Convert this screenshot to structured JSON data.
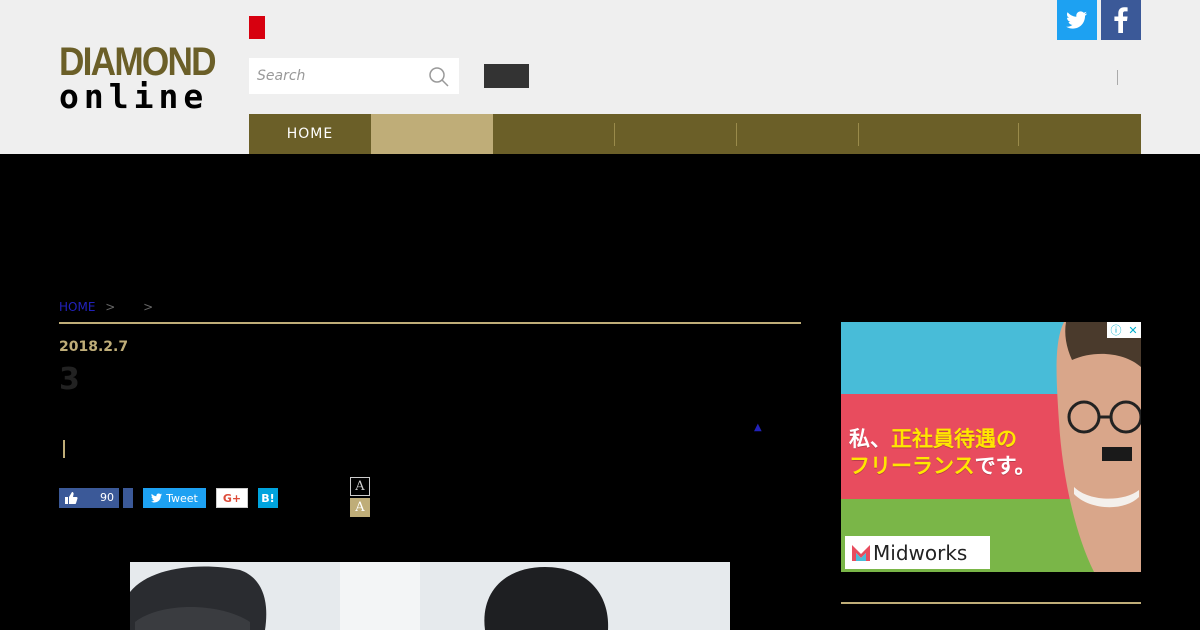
{
  "logo": {
    "line1": "DIAMOND",
    "line2": "online"
  },
  "search": {
    "placeholder": "Search"
  },
  "nav": {
    "items": [
      {
        "label": "HOME",
        "active": false
      },
      {
        "label": "",
        "active": true
      },
      {
        "label": "",
        "active": false
      },
      {
        "label": "",
        "active": false
      },
      {
        "label": "",
        "active": false
      },
      {
        "label": "",
        "active": false
      },
      {
        "label": "",
        "active": false
      }
    ]
  },
  "breadcrumb": {
    "home": "HOME",
    "sep1": ">",
    "sep2": ">"
  },
  "article": {
    "date": "2018.2.7",
    "title": "3"
  },
  "share": {
    "like_count": "90",
    "tweet_label": "Tweet",
    "gplus_label": "G+",
    "hatena_label": "B!"
  },
  "font_size": {
    "a1": "A",
    "a2": "A"
  },
  "ad": {
    "line1_white": "私、",
    "line1_yellow": "正社員待遇の",
    "line2_yellow": "フリーランス",
    "line2_white": "です。",
    "brand": "Midworks"
  },
  "colors": {
    "brand": "#6b5f28",
    "accent": "#bfad78",
    "twitter": "#1da1f2",
    "facebook": "#3b5998",
    "red": "#d7000f"
  }
}
